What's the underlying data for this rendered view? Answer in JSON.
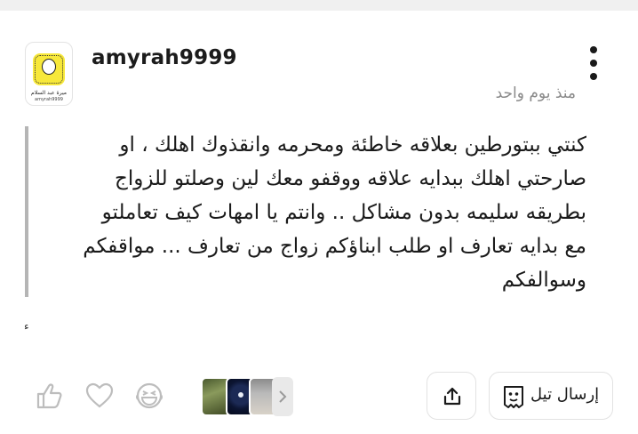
{
  "post": {
    "username": "amyrah9999",
    "avatar_caption_name": "ميرة عبد السلام",
    "avatar_caption_handle": "amyrah9999",
    "timestamp": "منذ يوم واحد",
    "body_lines": [
      "كنتي ببتورطين بعلاقه خاطئة ومحرمه وانقذوك اهلك ، او",
      "صارحتي اهلك ببدايه علاقه ووقفو معك لين وصلتو للزواج",
      "بطريقه سليمه بدون مشاكل ..  وانتم يا امهات كيف تعاملتو",
      "مع بدايه تعارف او طلب ابناؤكم زواج من تعارف ... مواقفكم",
      "وسوالفكم"
    ],
    "stray_mark": "ء"
  },
  "actions": {
    "reply_label": "إرسال تيل",
    "share_icon": "share-icon",
    "more_icon": "more-vertical-icon",
    "reactions": [
      "thumbs-up-icon",
      "heart-icon",
      "laugh-icon"
    ]
  }
}
